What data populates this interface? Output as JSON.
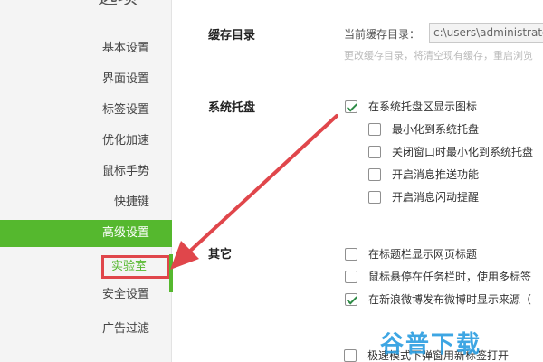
{
  "sidebar": {
    "title": "选项",
    "items": [
      {
        "label": "基本设置"
      },
      {
        "label": "界面设置"
      },
      {
        "label": "标签设置"
      },
      {
        "label": "优化加速"
      },
      {
        "label": "鼠标手势"
      },
      {
        "label": "快捷键"
      },
      {
        "label": "高级设置"
      },
      {
        "label": "实验室"
      },
      {
        "label": "安全设置"
      },
      {
        "label": "广告过滤"
      }
    ]
  },
  "cache": {
    "title": "缓存目录",
    "current_label": "当前缓存目录：",
    "path_value": "c:\\users\\administrato",
    "hint": "更改缓存目录，将清空现有缓存，重启浏览"
  },
  "tray": {
    "title": "系统托盘",
    "options": [
      {
        "label": "在系统托盘区显示图标",
        "checked": true
      },
      {
        "label": "最小化到系统托盘",
        "checked": false
      },
      {
        "label": "关闭窗口时最小化到系统托盘",
        "checked": false
      },
      {
        "label": "开启消息推送功能",
        "checked": false
      },
      {
        "label": "开启消息闪动提醒",
        "checked": false
      }
    ]
  },
  "other": {
    "title": "其它",
    "options": [
      {
        "label": "在标题栏显示网页标题",
        "checked": false
      },
      {
        "label": "鼠标悬停在任务栏时，使用多标签",
        "checked": false
      },
      {
        "label": "在新浪微博发布微博时显示来源（",
        "checked": true
      },
      {
        "label": "极速模式下弹窗用新标签打开",
        "checked": false
      }
    ]
  },
  "watermark": "谷普下载",
  "colors": {
    "accent": "#55b82e",
    "highlight": "#e0464b",
    "arrow": "#e0464b"
  }
}
